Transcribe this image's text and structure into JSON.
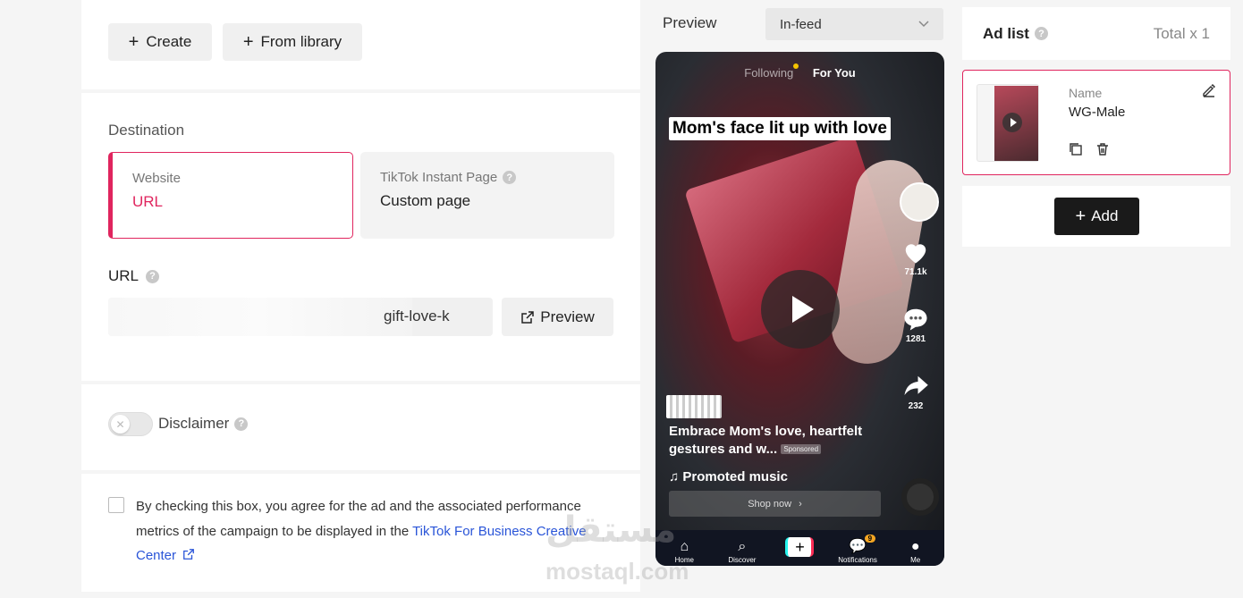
{
  "creative": {
    "create_label": "Create",
    "library_label": "From library"
  },
  "destination": {
    "title": "Destination",
    "website": {
      "label": "Website",
      "value": "URL"
    },
    "instant": {
      "label": "TikTok Instant Page",
      "value": "Custom page"
    }
  },
  "url": {
    "label": "URL",
    "value": "gift-love-k",
    "preview_label": "Preview"
  },
  "disclaimer": {
    "label": "Disclaimer",
    "enabled": false
  },
  "consent": {
    "text": "By checking this box, you agree for the ad and the associated performance metrics of the campaign to be displayed in the",
    "link": "TikTok For Business Creative Center"
  },
  "preview": {
    "label": "Preview",
    "placement": "In-feed",
    "tabs": {
      "following": "Following",
      "for_you": "For You"
    },
    "caption": "Mom's face lit up with love",
    "likes": "71.1k",
    "comments": "1281",
    "shares": "232",
    "description": "Embrace Mom's love, heartfelt gestures and w...",
    "sponsored": "Sponsored",
    "music": "Promoted music",
    "shop": "Shop now",
    "nav": {
      "home": "Home",
      "discover": "Discover",
      "notifications": "Notifications",
      "me": "Me",
      "badge": "9"
    }
  },
  "ad_list": {
    "title": "Ad list",
    "total": "Total x 1",
    "ad": {
      "name_label": "Name",
      "name": "WG-Male"
    },
    "add_label": "Add"
  },
  "watermark": {
    "arabic": "مستقل",
    "latin": "mostaql.com"
  },
  "colors": {
    "accent": "#e0255e",
    "link": "#2a55d8"
  }
}
